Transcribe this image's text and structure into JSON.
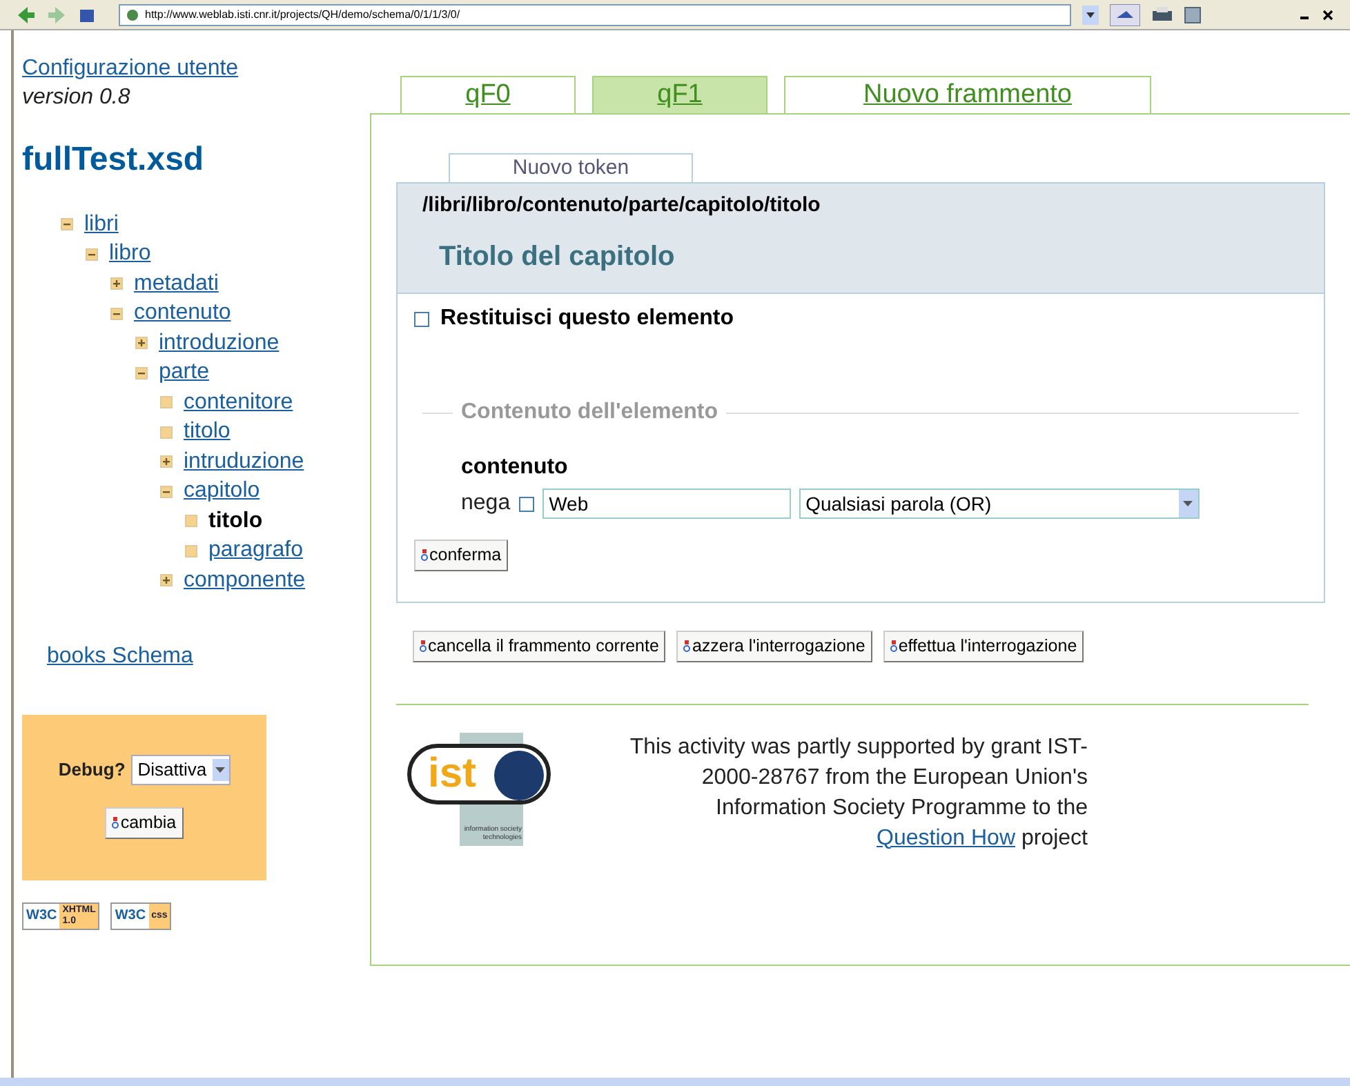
{
  "browser": {
    "url": "http://www.weblab.isti.cnr.it/projects/QH/demo/schema/0/1/1/3/0/"
  },
  "sidebar": {
    "config_link": "Configurazione utente",
    "version": "version 0.8",
    "schema_title": "fullTest.xsd",
    "tree": [
      {
        "label": "libri",
        "kind": "expanded",
        "selected": false,
        "children": [
          {
            "label": "libro",
            "kind": "expanded",
            "selected": false,
            "children": [
              {
                "label": "metadati",
                "kind": "collapsed",
                "selected": false
              },
              {
                "label": "contenuto",
                "kind": "expanded",
                "selected": false,
                "children": [
                  {
                    "label": "introduzione",
                    "kind": "collapsed",
                    "selected": false
                  },
                  {
                    "label": "parte",
                    "kind": "expanded",
                    "selected": false,
                    "children": [
                      {
                        "label": "contenitore",
                        "kind": "leaf",
                        "selected": false
                      },
                      {
                        "label": "titolo",
                        "kind": "leaf",
                        "selected": false
                      },
                      {
                        "label": "intruduzione",
                        "kind": "collapsed",
                        "selected": false
                      },
                      {
                        "label": "capitolo",
                        "kind": "expanded",
                        "selected": false,
                        "children": [
                          {
                            "label": "titolo",
                            "kind": "leaf",
                            "selected": true
                          },
                          {
                            "label": "paragrafo",
                            "kind": "leaf",
                            "selected": false
                          }
                        ]
                      },
                      {
                        "label": "componente",
                        "kind": "collapsed",
                        "selected": false
                      }
                    ]
                  }
                ]
              }
            ]
          }
        ]
      }
    ],
    "schema_link": "books Schema",
    "debug": {
      "label": "Debug?",
      "value": "Disattiva",
      "button": "cambia"
    },
    "badges": [
      {
        "w3c": "W3C",
        "name": "XHTML",
        "version": "1.0"
      },
      {
        "w3c": "W3C",
        "name": "css"
      }
    ]
  },
  "tabs": [
    {
      "label": "qF0",
      "selected": false
    },
    {
      "label": "qF1",
      "selected": true
    },
    {
      "label": "Nuovo frammento",
      "selected": false
    }
  ],
  "token_tab": "Nuovo token",
  "element": {
    "path": "/libri/libro/contenuto/parte/capitolo/titolo",
    "title": "Titolo del capitolo",
    "return_label": "Restituisci questo elemento",
    "return_checked": false,
    "fieldset_legend": "Contenuto dell'elemento",
    "field_name": "contenuto",
    "negate_label": "nega",
    "negate_checked": false,
    "value": "Web",
    "mode": "Qualsiasi parola (OR)",
    "confirm": "conferma"
  },
  "actions": [
    "cancella il frammento corrente",
    "azzera l'interrogazione",
    "effettua l'interrogazione"
  ],
  "footer": {
    "logo": {
      "word": "ist",
      "caption": "information society technologies"
    },
    "text_before": "This activity was partly supported by grant IST-2000-28767 from the European Union's Information Society Programme to the",
    "link": "Question How",
    "text_after": "project"
  }
}
